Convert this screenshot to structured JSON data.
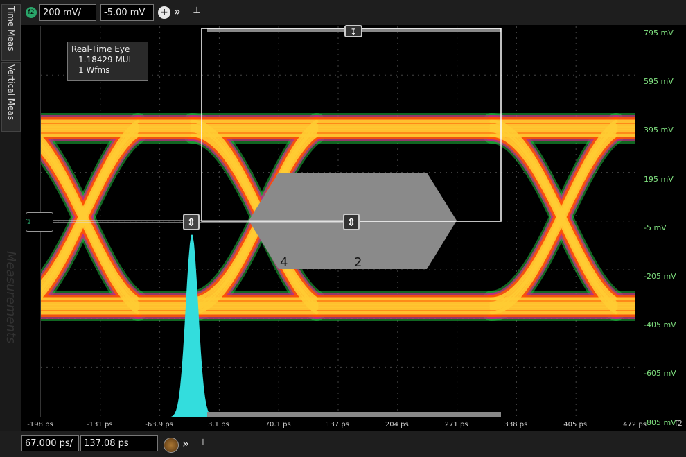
{
  "side_tabs": {
    "time_meas": "Time Meas",
    "vertical_meas": "Vertical Meas",
    "measurements": "Measurements"
  },
  "top": {
    "channel_badge": "f2",
    "vertical_scale": "200 mV/",
    "vertical_offset": "-5.00 mV",
    "add_icon": "plus-circle-icon",
    "more_icon": "double-chevron-right-icon",
    "pin_icon": "pin-icon"
  },
  "info_box": {
    "title": "Real-Time Eye",
    "mui": "1.18429 MUI",
    "wfms": "1 Wfms"
  },
  "y_ticks": [
    "795 mV",
    "595 mV",
    "395 mV",
    "195 mV",
    "-5 mV",
    "-205 mV",
    "-405 mV",
    "-605 mV",
    "-805 mV"
  ],
  "x_ticks": [
    "-198 ps",
    "-131 ps",
    "-63.9 ps",
    "3.1 ps",
    "70.1 ps",
    "137 ps",
    "204 ps",
    "271 ps",
    "338 ps",
    "405 ps",
    "472 ps"
  ],
  "x_axis_label": "f2",
  "left_marker_label": "f2",
  "mask_zones": {
    "zone_left": "4",
    "zone_right": "2"
  },
  "bottom": {
    "horizontal_scale": "67.000 ps/",
    "horizontal_position": "137.08 ps",
    "expand_icon": "double-chevron-right-icon",
    "pin_icon": "pin-icon",
    "dial_icon": "dial-icon"
  },
  "colors": {
    "background": "#000000",
    "eye_core": "#ffcc33",
    "eye_mid": "#ff5500",
    "eye_outer": "#cc2288",
    "eye_fringe": "#22cc44",
    "mask": "#8a8a8a",
    "histogram": "#33dddd",
    "axis_text": "#7fe07f"
  }
}
